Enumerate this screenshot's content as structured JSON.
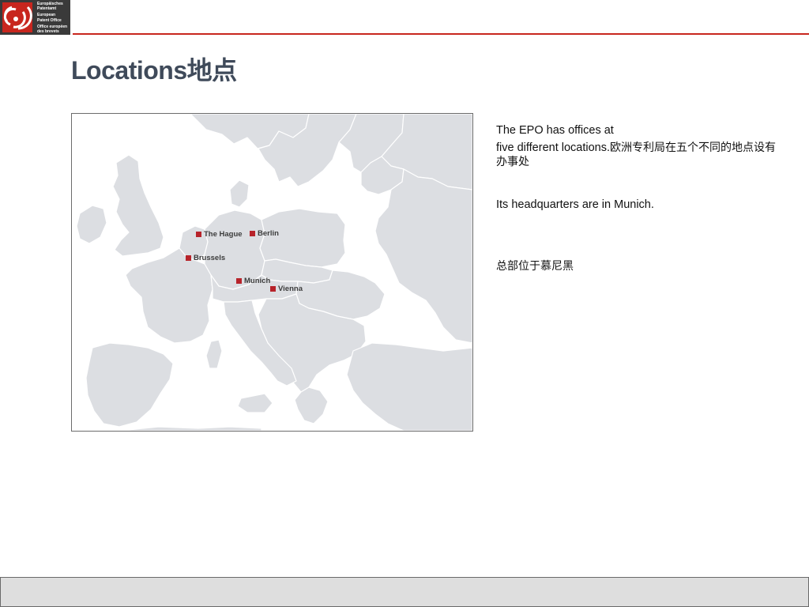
{
  "header": {
    "logo_lines": [
      "Europäisches",
      "Patentamt",
      "European",
      "Patent Office",
      "Office européen",
      "des brevets"
    ],
    "accent_color": "#c8261e",
    "logo_bg": "#3a3a3a"
  },
  "slide": {
    "title": "Locations地点"
  },
  "map": {
    "marker_color": "#b7232a",
    "land_color": "#dcdee2",
    "locations": [
      {
        "name": "The Hague"
      },
      {
        "name": "Berlin"
      },
      {
        "name": "Brussels"
      },
      {
        "name": "Munich"
      },
      {
        "name": "Vienna"
      }
    ]
  },
  "body": {
    "line1": "The EPO has offices at",
    "line2_en": "five different locations.",
    "line2_cn": "欧洲专利局在五个不同的地点设有办事处",
    "hq_en": "Its headquarters are in Munich.",
    "hq_cn": "总部位于慕尼黑"
  }
}
